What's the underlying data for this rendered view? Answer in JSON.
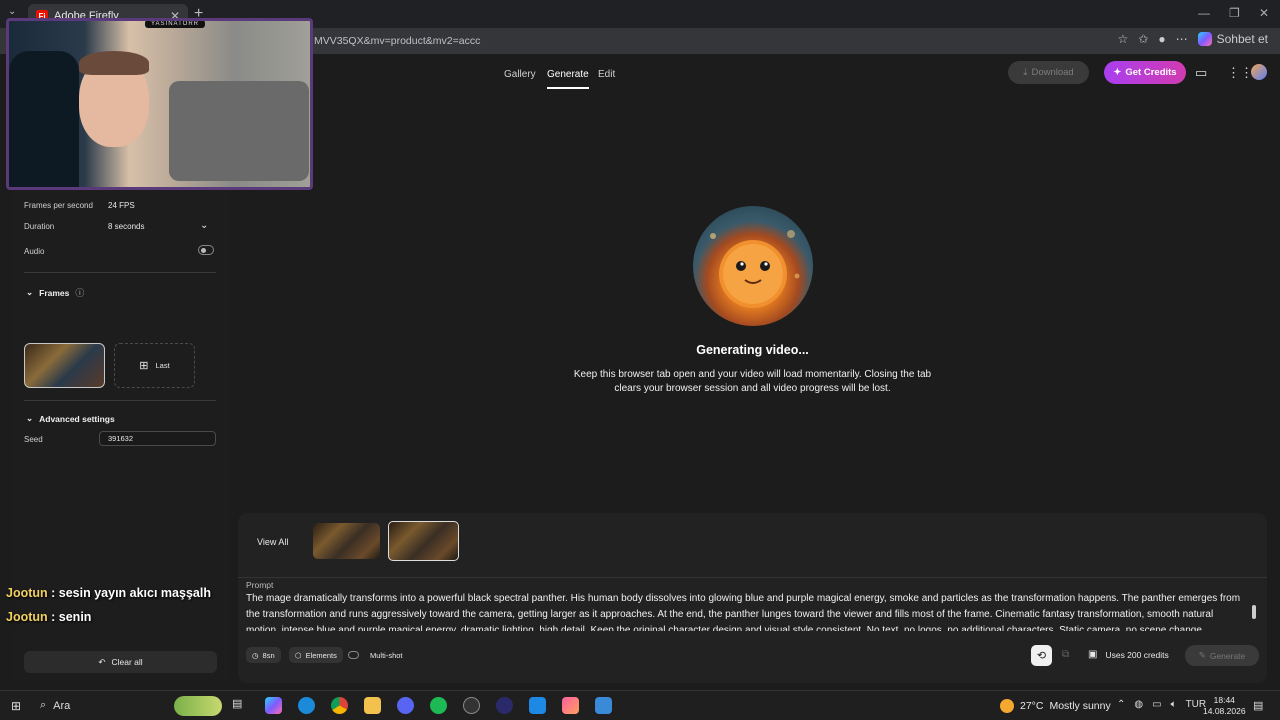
{
  "browser": {
    "tab_title": "Adobe Firefly",
    "tab_favicon": "Fi",
    "url": "MVV35QX&mv=product&mv2=accc",
    "sohbet_label": "Sohbet et"
  },
  "nav": {
    "links": [
      "Gallery",
      "Generate",
      "Edit"
    ],
    "download_label": "Download",
    "get_credits_label": "Get Credits"
  },
  "settings": {
    "fps_label": "Frames per second",
    "fps_value": "24 FPS",
    "duration_label": "Duration",
    "duration_value": "8 seconds",
    "audio_label": "Audio",
    "frames_title": "Frames",
    "last_label": "Last",
    "advanced_title": "Advanced settings",
    "seed_label": "Seed",
    "seed_value": "391632",
    "clear_all_label": "Clear all"
  },
  "status": {
    "title": "Generating video...",
    "description": "Keep this browser tab open and your video will load momentarily. Closing the tab clears your browser session and all video progress will be lost."
  },
  "composer": {
    "view_all_label": "View All",
    "prompt_label": "Prompt",
    "prompt_text": "The mage dramatically transforms into a powerful black spectral panther. His human body dissolves into glowing blue and purple magical energy, smoke and particles as the transformation happens. The panther emerges from the transformation and runs aggressively toward the camera, getting larger as it approaches. At the end, the panther lunges toward the viewer and fills most of the frame. Cinematic fantasy transformation, smooth natural motion, intense blue and purple magical energy, dramatic lighting, high detail. Keep the original character design and visual style consistent. No text, no logos, no additional characters. Static camera, no scene change.",
    "duration_chip": "8sn",
    "elements_chip": "Elements",
    "multishot_label": "Multi-shot",
    "uses_credits": "Uses 200 credits",
    "generate_label": "Generate"
  },
  "overlay": {
    "webcam_label": "YASINATORR",
    "chat": [
      {
        "nick": "Jootun",
        "message": " : sesin yayın akıcı maşşalh"
      },
      {
        "nick": "Jootun",
        "message": " : senin"
      }
    ]
  },
  "taskbar": {
    "search_label": "Ara",
    "weather_temp": "27°C",
    "weather_text": "Mostly sunny",
    "lang": "TUR",
    "time": "18:44",
    "date": "14.08.2026"
  },
  "colors": {
    "accent_gradient_start": "#a93ff0",
    "accent_gradient_end": "#d23bb0",
    "background": "#1c1c1c"
  }
}
